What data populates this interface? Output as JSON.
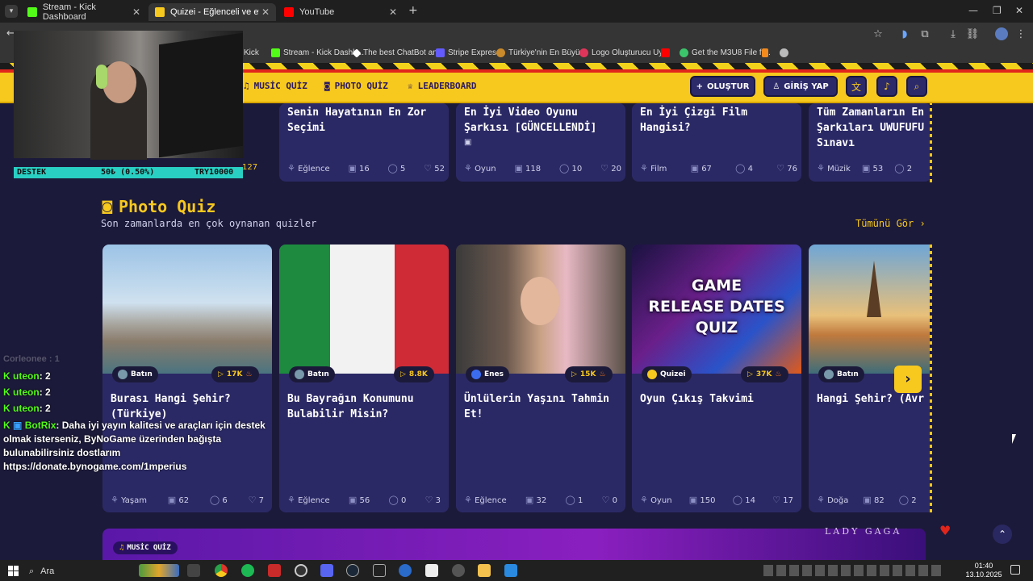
{
  "browser": {
    "tabs": [
      {
        "label": "Stream - Kick Dashboard",
        "color": "#53fc18"
      },
      {
        "label": "Quizei - Eğlenceli ve etkileşimli",
        "color": "#f7c81e"
      },
      {
        "label": "YouTube",
        "color": "#ff0000"
      }
    ],
    "bookmarks": [
      "Kick",
      "Stream - Kick Dashb...",
      "The best ChatBot an...",
      "Stripe Express",
      "Türkiye'nin En Büyü...",
      "Logo Oluşturucu Uy...",
      "Get the M3U8 File fr..."
    ]
  },
  "nav": {
    "music_quiz": "MUSİC QUİZ",
    "photo_quiz": "PHOTO QUİZ",
    "leaderboard": "LEADERBOARD",
    "create": "OLUŞTUR",
    "login": "GİRİŞ YAP"
  },
  "webcam": {
    "goal_label": "DESTEK",
    "goal_value": "50₺ (0.50%)",
    "goal_target": "TRY10000"
  },
  "top_cards": [
    {
      "title": "Senin Hayatının En Zor Seçimi",
      "category": "Eğlence",
      "questions": "16",
      "comments": "5",
      "likes": "52"
    },
    {
      "title": "En İyi Video Oyunu Şarkısı [GÜNCELLENDİ]",
      "category": "Oyun",
      "questions": "118",
      "comments": "10",
      "likes": "20"
    },
    {
      "title": "En İyi Çizgi Film Hangisi?",
      "category": "Film",
      "questions": "67",
      "comments": "4",
      "likes": "76"
    },
    {
      "title": "Tüm Zamanların En Şarkıları UWUFUFU Sınavı",
      "category": "Müzik",
      "questions": "53",
      "comments": "2",
      "likes": ""
    }
  ],
  "top_partial_likes": "127",
  "photo_section": {
    "title": "Photo Quiz",
    "subtitle": "Son zamanlarda en çok oynanan quizler",
    "see_all": "Tümünü Gör"
  },
  "photo_cards": [
    {
      "author": "Batın",
      "plays": "17K",
      "title": "Burası Hangi Şehir? (Türkiye)",
      "category": "Yaşam",
      "questions": "62",
      "comments": "6",
      "likes": "7"
    },
    {
      "author": "Batın",
      "plays": "8.8K",
      "title": "Bu Bayrağın Konumunu Bulabilir Misin?",
      "category": "Eğlence",
      "questions": "56",
      "comments": "0",
      "likes": "3"
    },
    {
      "author": "Enes",
      "plays": "15K",
      "title": "Ünlülerin Yaşını Tahmin Et!",
      "category": "Eğlence",
      "questions": "32",
      "comments": "1",
      "likes": "0"
    },
    {
      "author": "Quizei",
      "plays": "37K",
      "title": "Oyun Çıkış Takvimi",
      "category": "Oyun",
      "questions": "150",
      "comments": "14",
      "likes": "17"
    },
    {
      "author": "Batın",
      "plays": "",
      "title": "Hangi Şehir? (Avr",
      "category": "Doğa",
      "questions": "82",
      "comments": "2",
      "likes": ""
    }
  ],
  "game_thumb": {
    "line1": "GAME",
    "line2": "RELEASE DATES",
    "line3": "QUIZ"
  },
  "music_banner": {
    "label": "MUSİC QUİZ",
    "artist": "LADY GAGA"
  },
  "chat": [
    {
      "user": "uteon",
      "text": ": 2"
    },
    {
      "user": "uteon",
      "text": ": 2"
    },
    {
      "user": "uteon",
      "text": ": 2"
    },
    {
      "user": "BotRix",
      "text": ": Daha iyi yayın kalitesi ve araçları için destek olmak isterseniz, ByNoGame üzerinden bağışta bulunabilirsiniz dostlarım https://donate.bynogame.com/1mperius"
    }
  ],
  "chat_faded": "Corleonee : 1",
  "taskbar": {
    "search": "Ara",
    "time": "01:40",
    "date": "13.10.2025"
  }
}
